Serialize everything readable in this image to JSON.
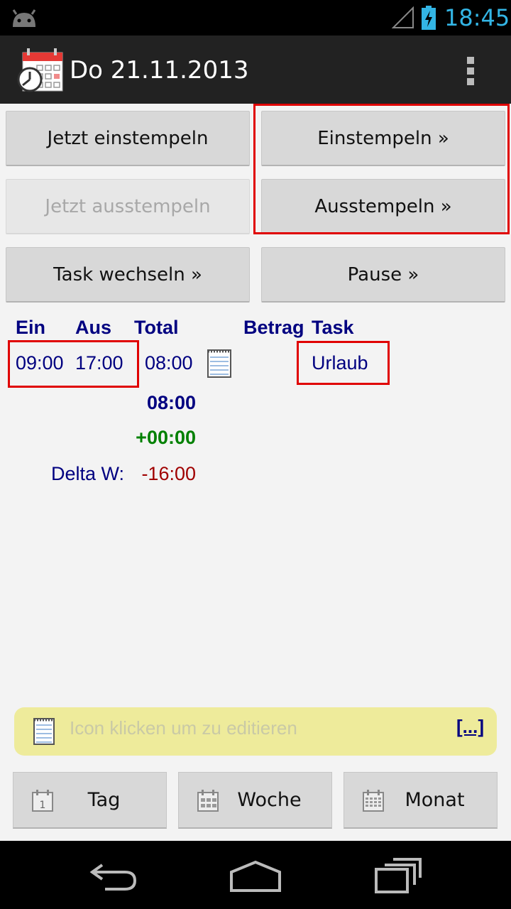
{
  "status_bar": {
    "time": "18:45",
    "time_color": "#33b5e5"
  },
  "action_bar": {
    "title": "Do 21.11.2013",
    "app_icon": "calendar-clock-icon",
    "overflow_icon": "overflow-menu-icon"
  },
  "buttons": {
    "clock_in_now": "Jetzt einstempeln",
    "clock_in": "Einstempeln »",
    "clock_out_now": "Jetzt ausstempeln",
    "clock_out": "Ausstempeln »",
    "change_task": "Task wechseln »",
    "pause": "Pause »"
  },
  "table": {
    "headers": {
      "in": "Ein",
      "out": "Aus",
      "total": "Total",
      "amount": "Betrag",
      "task": "Task"
    },
    "rows": [
      {
        "in": "09:00",
        "out": "17:00",
        "total": "08:00",
        "task": "Urlaub"
      }
    ],
    "sum_total": "08:00",
    "balance": "+00:00",
    "delta_label": "Delta W:",
    "delta_value": "-16:00"
  },
  "colors": {
    "header": "#000080",
    "balance_positive": "#008000",
    "delta_negative": "#a00000",
    "highlight": "#e00000"
  },
  "memo": {
    "placeholder": "Icon klicken um zu editieren",
    "more": "[...]"
  },
  "nav": {
    "day": "Tag",
    "week": "Woche",
    "month": "Monat"
  }
}
